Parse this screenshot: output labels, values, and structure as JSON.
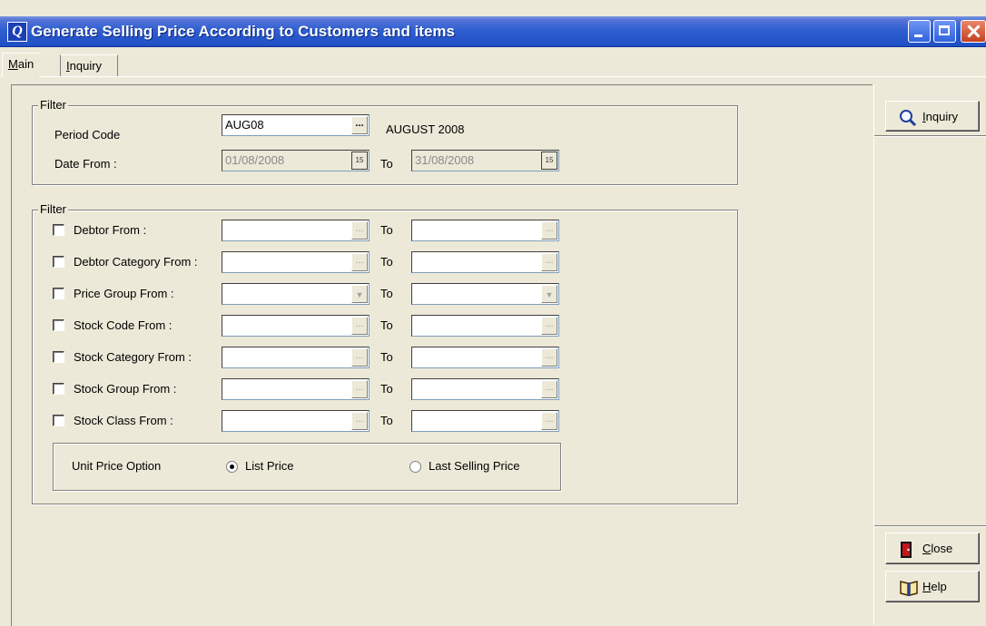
{
  "window": {
    "icon_letter": "Q",
    "title": "Generate Selling Price According to Customers and items"
  },
  "tabs": [
    {
      "label": "Main",
      "underline": "M",
      "rest": "ain"
    },
    {
      "label": "Inquiry",
      "underline": "I",
      "rest": "nquiry"
    }
  ],
  "filter1": {
    "title": "Filter",
    "period_code_label": "Period Code",
    "period_code_value": "AUG08",
    "period_code_desc": "AUGUST 2008",
    "date_from_label": "Date From :",
    "date_from_value": "01/08/2008",
    "to_label": "To",
    "date_to_value": "31/08/2008",
    "calendar_icon_text": "15"
  },
  "filter2": {
    "title": "Filter",
    "to_label": "To",
    "rows": [
      {
        "label": "Debtor From :"
      },
      {
        "label": "Debtor Category From :"
      },
      {
        "label": "Price Group From :"
      },
      {
        "label": "Stock Code From :"
      },
      {
        "label": "Stock Category From :"
      },
      {
        "label": "Stock Group From :"
      },
      {
        "label": "Stock Class From :"
      }
    ],
    "unit_price": {
      "label": "Unit Price  Option",
      "options": [
        {
          "label": "List Price",
          "selected": true
        },
        {
          "label": "Last Selling Price",
          "selected": false
        }
      ]
    }
  },
  "buttons": {
    "inquiry": {
      "underline": "I",
      "rest": "nquiry"
    },
    "close": {
      "underline": "C",
      "rest": "lose"
    },
    "help": {
      "underline": "H",
      "rest": "elp"
    }
  },
  "ellipsis": "..."
}
